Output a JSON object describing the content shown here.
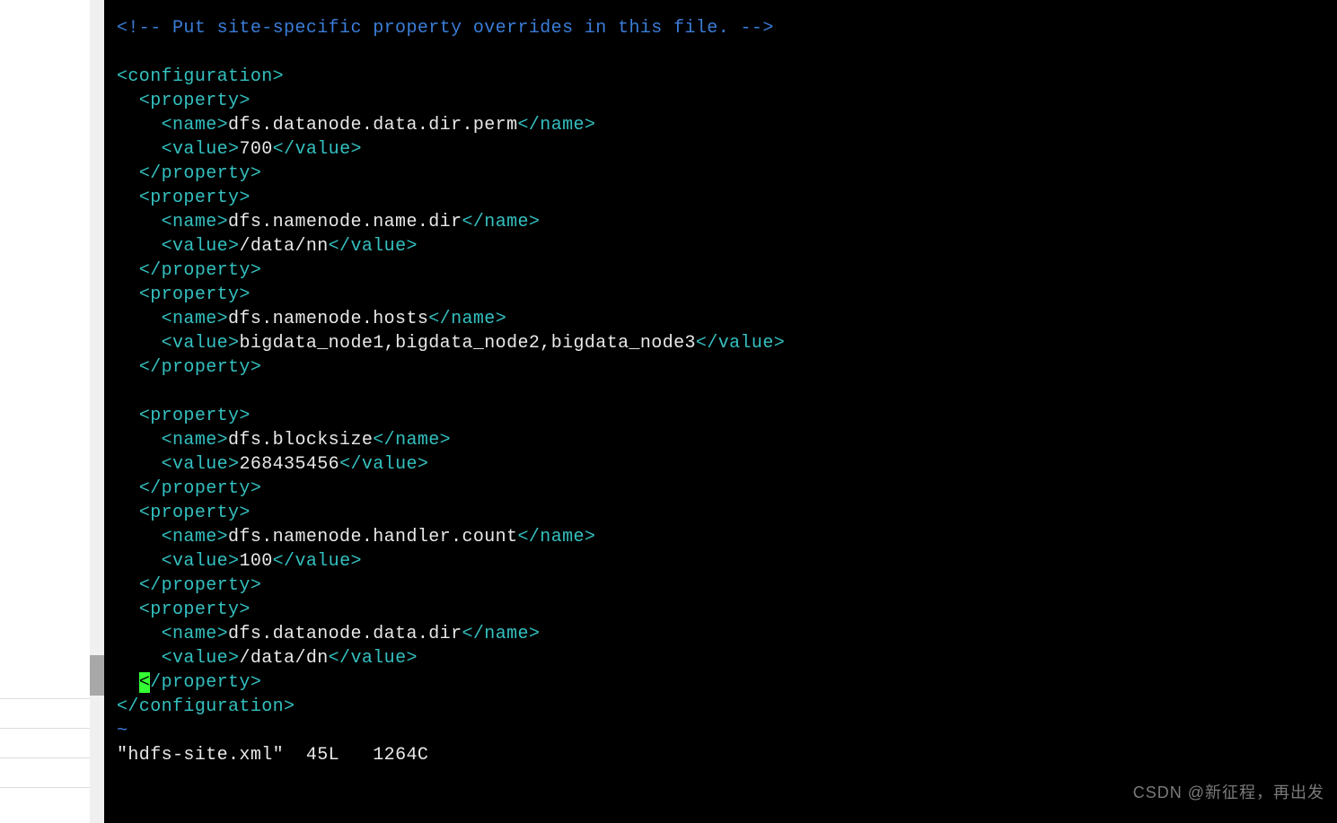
{
  "comment": "<!-- Put site-specific property overrides in this file. -->",
  "tags": {
    "config_open": "<configuration>",
    "config_close": "</configuration>",
    "prop_open": "<property>",
    "prop_close": "</property>",
    "name_open": "<name>",
    "name_close": "</name>",
    "value_open": "<value>",
    "value_close": "</value>",
    "tilde": "~"
  },
  "cursor_char": "<",
  "cursor_rest_close": "/property>",
  "properties": [
    {
      "name": "dfs.datanode.data.dir.perm",
      "value": "700"
    },
    {
      "name": "dfs.namenode.name.dir",
      "value": "/data/nn"
    },
    {
      "name": "dfs.namenode.hosts",
      "value": "bigdata_node1,bigdata_node2,bigdata_node3"
    },
    {
      "name": "dfs.blocksize",
      "value": "268435456"
    },
    {
      "name": "dfs.namenode.handler.count",
      "value": "100"
    },
    {
      "name": "dfs.datanode.data.dir",
      "value": "/data/dn"
    }
  ],
  "status_quote": "\"",
  "status_text": "hdfs-site.xml",
  "status_tail": "  45L   1264C",
  "watermark": "CSDN @新征程，再出发"
}
